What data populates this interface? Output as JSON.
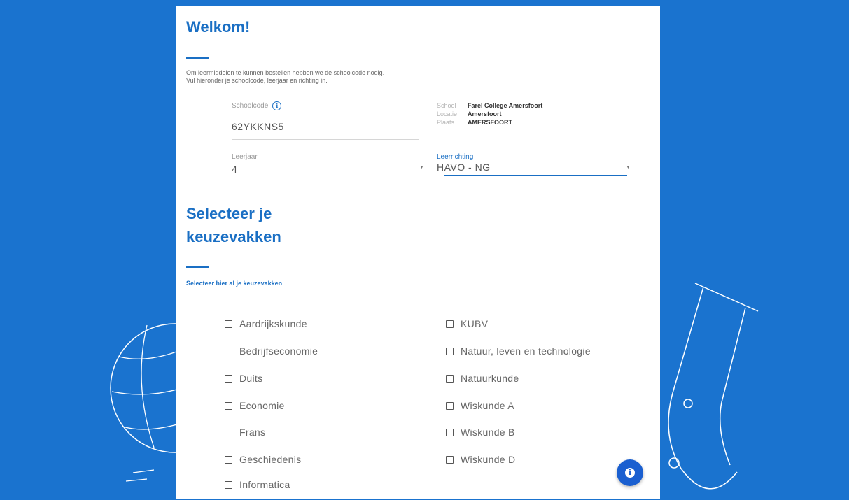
{
  "colors": {
    "background": "#1a73cf",
    "accent": "#1a6fc4",
    "fab": "#1a5fd0"
  },
  "header": {
    "title": "Welkom!"
  },
  "intro": {
    "line1": "Om leermiddelen te kunnen bestellen hebben we de schoolcode nodig.",
    "line2": "Vul hieronder je schoolcode, leerjaar en richting in."
  },
  "schoolcode": {
    "label": "Schoolcode",
    "value": "62YKKNS5",
    "info_icon": "info-icon"
  },
  "school_info": {
    "school_label": "School",
    "school_value": "Farel College Amersfoort",
    "locatie_label": "Locatie",
    "locatie_value": "Amersfoort",
    "plaats_label": "Plaats",
    "plaats_value": "AMERSFOORT"
  },
  "leerjaar": {
    "label": "Leerjaar",
    "value": "4"
  },
  "leerrichting": {
    "label": "Leerrichting",
    "value": "HAVO - NG"
  },
  "electives": {
    "title": "Selecteer je keuzevakken",
    "subtitle": "Selecteer hier al je keuzevakken",
    "left": [
      "Aardrijkskunde",
      "Bedrijfseconomie",
      "Duits",
      "Economie",
      "Frans",
      "Geschiedenis",
      "Informatica"
    ],
    "right": [
      "KUBV",
      "Natuur, leven en technologie",
      "Natuurkunde",
      "Wiskunde A",
      "Wiskunde B",
      "Wiskunde D"
    ]
  },
  "fab": {
    "icon": "info-icon",
    "glyph": "i"
  }
}
